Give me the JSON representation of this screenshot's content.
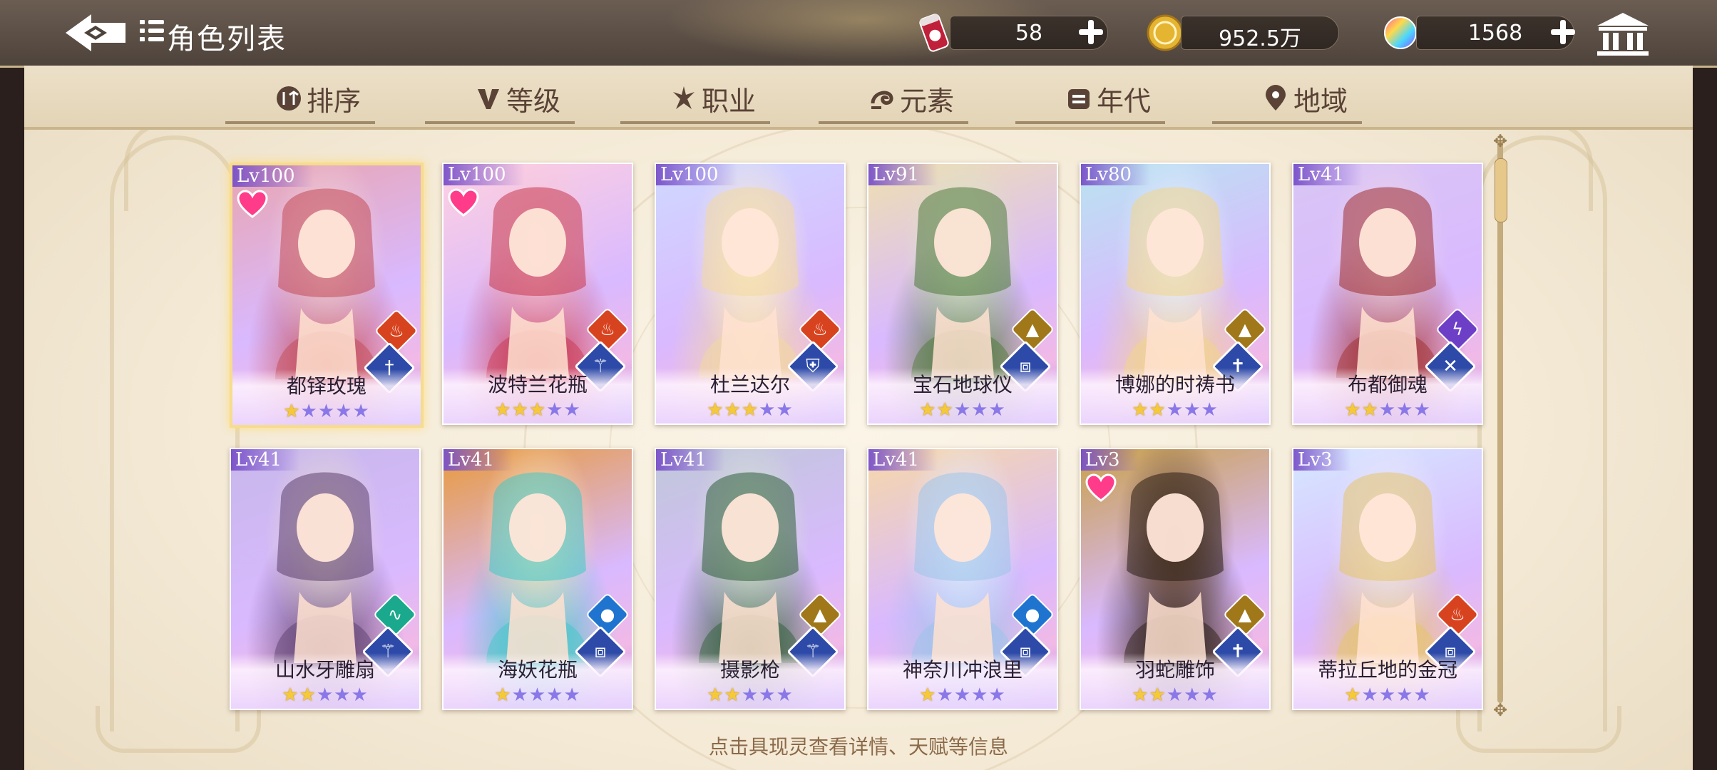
{
  "header": {
    "title": "角色列表",
    "resources": [
      {
        "name": "stamina-can",
        "value": "58",
        "has_plus": true
      },
      {
        "name": "gold-coin",
        "value": "952.5万",
        "has_plus": false
      },
      {
        "name": "rainbow-gem",
        "value": "1568",
        "has_plus": true
      }
    ]
  },
  "tabs": [
    {
      "label": "排序",
      "icon": "sort-icon"
    },
    {
      "label": "等级",
      "icon": "level-icon"
    },
    {
      "label": "职业",
      "icon": "class-icon"
    },
    {
      "label": "元素",
      "icon": "element-icon"
    },
    {
      "label": "年代",
      "icon": "era-icon"
    },
    {
      "label": "地域",
      "icon": "region-icon"
    }
  ],
  "cards": [
    {
      "lv": "Lv100",
      "name": "都铎玫瑰",
      "stars": 1,
      "max_stars": 5,
      "favorite": true,
      "element": "fire",
      "job": "sword",
      "selected": true
    },
    {
      "lv": "Lv100",
      "name": "波特兰花瓶",
      "stars": 3,
      "max_stars": 5,
      "favorite": true,
      "element": "fire",
      "job": "staff",
      "selected": false
    },
    {
      "lv": "Lv100",
      "name": "杜兰达尔",
      "stars": 3,
      "max_stars": 5,
      "favorite": false,
      "element": "fire",
      "job": "shield",
      "selected": false
    },
    {
      "lv": "Lv91",
      "name": "宝石地球仪",
      "stars": 2,
      "max_stars": 5,
      "favorite": false,
      "element": "earth",
      "job": "book",
      "selected": false
    },
    {
      "lv": "Lv80",
      "name": "博娜的时祷书",
      "stars": 2,
      "max_stars": 5,
      "favorite": false,
      "element": "earth",
      "job": "cross",
      "selected": false
    },
    {
      "lv": "Lv41",
      "name": "布都御魂",
      "stars": 2,
      "max_stars": 5,
      "favorite": false,
      "element": "thunder",
      "job": "blades",
      "selected": false
    },
    {
      "lv": "Lv41",
      "name": "山水牙雕扇",
      "stars": 2,
      "max_stars": 5,
      "favorite": false,
      "element": "wind",
      "job": "staff",
      "selected": false
    },
    {
      "lv": "Lv41",
      "name": "海妖花瓶",
      "stars": 1,
      "max_stars": 5,
      "favorite": false,
      "element": "water",
      "job": "book",
      "selected": false
    },
    {
      "lv": "Lv41",
      "name": "摄影枪",
      "stars": 2,
      "max_stars": 5,
      "favorite": false,
      "element": "earth",
      "job": "staff",
      "selected": false
    },
    {
      "lv": "Lv41",
      "name": "神奈川冲浪里",
      "stars": 1,
      "max_stars": 5,
      "favorite": false,
      "element": "water",
      "job": "book",
      "selected": false
    },
    {
      "lv": "Lv3",
      "name": "羽蛇雕饰",
      "stars": 2,
      "max_stars": 5,
      "favorite": true,
      "element": "earth",
      "job": "cross",
      "selected": false
    },
    {
      "lv": "Lv3",
      "name": "蒂拉丘地的金冠",
      "stars": 1,
      "max_stars": 5,
      "favorite": false,
      "element": "fire",
      "job": "book",
      "selected": false
    }
  ],
  "hint": "点击具现灵查看详情、天赋等信息",
  "colors": {
    "fire": "#d8431f",
    "earth": "#a0781a",
    "water": "#1f74d0",
    "wind": "#1aa98c",
    "thunder": "#6d3fc7",
    "job": "#2d4aa8",
    "star_on": "#f5c938",
    "star_off": "#8a78e8"
  }
}
